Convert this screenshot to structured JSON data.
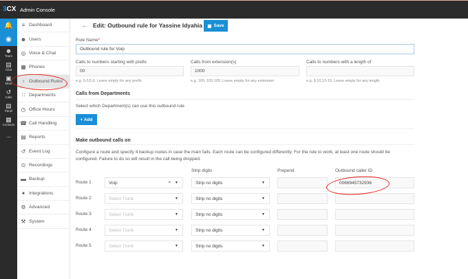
{
  "app": {
    "logo": "3CX",
    "title": "Admin Console"
  },
  "rail": [
    {
      "icon": "bell-icon",
      "label": ""
    },
    {
      "icon": "status-icon",
      "label": ""
    },
    {
      "icon": "team-icon",
      "label": "Team"
    },
    {
      "icon": "chat-icon",
      "label": "Chat"
    },
    {
      "icon": "meet-icon",
      "label": "Meet"
    },
    {
      "icon": "calls-icon",
      "label": "Calls"
    },
    {
      "icon": "panel-icon",
      "label": "Panel"
    },
    {
      "icon": "contacts-icon",
      "label": "Contacts"
    },
    {
      "icon": "more-icon",
      "label": "..."
    }
  ],
  "sidebar": [
    {
      "label": "Dashboard",
      "icon": "dashboard-icon"
    },
    {
      "label": "Users",
      "icon": "user-icon"
    },
    {
      "label": "Voice & Chat",
      "icon": "globe-icon"
    },
    {
      "label": "Phones",
      "icon": "phone-grid-icon"
    },
    {
      "label": "Outbound Rules",
      "icon": "arrow-up-icon",
      "active": true
    },
    {
      "label": "Departments",
      "icon": "departments-icon"
    },
    {
      "label": "Office Hours",
      "icon": "clock-icon"
    },
    {
      "label": "Call Handling",
      "icon": "handset-icon"
    },
    {
      "label": "Reports",
      "icon": "reports-icon"
    },
    {
      "label": "Event Log",
      "icon": "history-icon"
    },
    {
      "label": "Recordings",
      "icon": "record-icon"
    },
    {
      "label": "Backup",
      "icon": "backup-icon"
    },
    {
      "label": "Integrations",
      "icon": "puzzle-icon"
    },
    {
      "label": "Advanced",
      "icon": "cog-icon"
    },
    {
      "label": "System",
      "icon": "wrench-icon"
    }
  ],
  "header": {
    "title": "Edit: Outbound rule for Yassine Idyahia",
    "save": "Save"
  },
  "form": {
    "rule_name_label": "Rule Name",
    "required_mark": "*",
    "rule_name_value": "Outbound rule for Voip",
    "prefix_label": "Calls to numbers starting with prefix",
    "prefix_value": "00",
    "prefix_help": "e.g. 0-3,5,6. Leave empty for any prefix",
    "ext_label": "Calls from extension(s)",
    "ext_value": "1000",
    "ext_help": "e.g. 100, 103-105. Leave empty for any extension",
    "len_label": "Calls to numbers with a length of",
    "len_value": "",
    "len_help": "e.g. 9,10,13-15. Leave empty for any length"
  },
  "departments": {
    "heading": "Calls from Departments",
    "text": "Select which Department(s) can use this outbound rule",
    "add": "+ Add"
  },
  "routes": {
    "heading": "Make outbound calls on",
    "text1": "Configure a route and specify 4 backup routes in case the main fails. Each route can be configured differently. For the rule to work, at least one route should be",
    "text2": "configured. Failure to do so will result in the call being dropped.",
    "col_strip": "Strip digits",
    "col_prepend": "Prepend",
    "col_caller": "Outbound caller ID",
    "trunk_placeholder": "Select Trunk",
    "rows": [
      {
        "label": "Route 1",
        "trunk": "Voip",
        "strip": "Strip no digits",
        "prepend": "",
        "caller_id": "0066945732936"
      },
      {
        "label": "Route 2",
        "trunk": "",
        "strip": "Strip no digits",
        "prepend": "",
        "caller_id": ""
      },
      {
        "label": "Route 3",
        "trunk": "",
        "strip": "Strip no digits",
        "prepend": "",
        "caller_id": ""
      },
      {
        "label": "Route 4",
        "trunk": "",
        "strip": "Strip no digits",
        "prepend": "",
        "caller_id": ""
      },
      {
        "label": "Route 5",
        "trunk": "",
        "strip": "Strip no digits",
        "prepend": "",
        "caller_id": ""
      }
    ]
  },
  "colors": {
    "accent": "#1a8fd6",
    "topbar": "#2b2b2b",
    "annotation": "#e0201a"
  }
}
